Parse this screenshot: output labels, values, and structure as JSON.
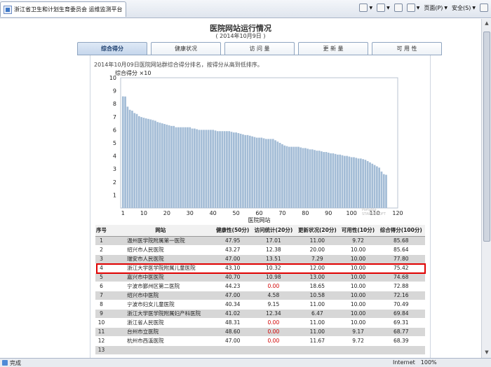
{
  "browser": {
    "tab_title": "浙江省卫生和计划生育委员会 运维监测平台",
    "tools": {
      "page": "页面(P)",
      "safety": "安全(S)"
    },
    "status": {
      "done": "完成",
      "zone": "Internet",
      "zoom": "100%"
    }
  },
  "page": {
    "title": "医院网站运行情况",
    "date": "( 2014年10月9日 )",
    "tabs": [
      {
        "label": "综合得分",
        "active": true
      },
      {
        "label": "健康状况",
        "active": false
      },
      {
        "label": "访 问 量",
        "active": false
      },
      {
        "label": "更 新 量",
        "active": false
      },
      {
        "label": "可 用 性",
        "active": false
      }
    ],
    "description": "2014年10月09日医院网站群综合得分排名，按得分从高到低排序。"
  },
  "chart_data": {
    "type": "bar",
    "ylabel": "综合得分 ×10",
    "xlabel": "医院网站",
    "ylim": [
      0,
      10
    ],
    "xlim": [
      0,
      120
    ],
    "yticks": [
      1,
      2,
      3,
      4,
      5,
      6,
      7,
      8,
      9,
      10
    ],
    "xticks": [
      1,
      10,
      20,
      30,
      40,
      50,
      60,
      70,
      80,
      90,
      100,
      110,
      120
    ],
    "bar_color": "#a3bcd6",
    "values": [
      8.57,
      8.56,
      7.78,
      7.54,
      7.47,
      7.29,
      7.22,
      7.05,
      6.98,
      6.93,
      6.88,
      6.84,
      6.8,
      6.75,
      6.7,
      6.6,
      6.55,
      6.5,
      6.45,
      6.4,
      6.35,
      6.3,
      6.3,
      6.2,
      6.2,
      6.2,
      6.2,
      6.2,
      6.2,
      6.2,
      6.1,
      6.1,
      6.05,
      6.0,
      6.0,
      6.0,
      6.0,
      6.0,
      6.0,
      6.0,
      5.95,
      5.9,
      5.9,
      5.9,
      5.9,
      5.9,
      5.9,
      5.85,
      5.8,
      5.8,
      5.75,
      5.7,
      5.65,
      5.6,
      5.6,
      5.55,
      5.5,
      5.45,
      5.4,
      5.4,
      5.4,
      5.35,
      5.3,
      5.3,
      5.3,
      5.3,
      5.2,
      5.1,
      5.0,
      4.9,
      4.8,
      4.75,
      4.7,
      4.7,
      4.7,
      4.7,
      4.7,
      4.65,
      4.6,
      4.6,
      4.55,
      4.5,
      4.5,
      4.45,
      4.4,
      4.4,
      4.35,
      4.3,
      4.3,
      4.25,
      4.2,
      4.2,
      4.15,
      4.1,
      4.1,
      4.05,
      4.0,
      4.0,
      3.95,
      3.9,
      3.9,
      3.85,
      3.8,
      3.8,
      3.75,
      3.7,
      3.6,
      3.5,
      3.4,
      3.3,
      3.2,
      3.1,
      2.8,
      2.6,
      2.55
    ]
  },
  "table": {
    "headers": [
      "序号",
      "网站",
      "健康性(50分)",
      "访问统计(20分)",
      "更新状况(20分)",
      "可用性(10分)",
      "综合得分(100分)"
    ],
    "rows": [
      [
        "1",
        "温州医学院附属第一医院",
        "47.95",
        "17.01",
        "11.00",
        "9.72",
        "85.68"
      ],
      [
        "2",
        "绍兴市人民医院",
        "43.27",
        "12.38",
        "20.00",
        "10.00",
        "85.64"
      ],
      [
        "3",
        "瑞安市人民医院",
        "47.00",
        "13.51",
        "7.29",
        "10.00",
        "77.80"
      ],
      [
        "4",
        "浙江大学医学院附属儿童医院",
        "43.10",
        "10.32",
        "12.00",
        "10.00",
        "75.42"
      ],
      [
        "5",
        "嘉兴市中医医院",
        "40.70",
        "10.98",
        "13.00",
        "10.00",
        "74.68"
      ],
      [
        "6",
        "宁波市鄞州区第二医院",
        "44.23",
        "0.00",
        "18.65",
        "10.00",
        "72.88"
      ],
      [
        "7",
        "绍兴市中医院",
        "47.00",
        "4.58",
        "10.58",
        "10.00",
        "72.16"
      ],
      [
        "8",
        "宁波市妇女儿童医院",
        "40.34",
        "9.15",
        "11.00",
        "10.00",
        "70.49"
      ],
      [
        "9",
        "浙江大学医学院附属妇产科医院",
        "41.02",
        "12.34",
        "6.47",
        "10.00",
        "69.84"
      ],
      [
        "10",
        "浙江省人民医院",
        "48.31",
        "0.00",
        "11.00",
        "10.00",
        "69.31"
      ],
      [
        "11",
        "台州市立医院",
        "48.60",
        "0.00",
        "11.00",
        "9.17",
        "68.77"
      ],
      [
        "12",
        "杭州市西溪医院",
        "47.00",
        "0.00",
        "11.67",
        "9.72",
        "68.39"
      ],
      [
        "13",
        "",
        "",
        "",
        "",
        "",
        ""
      ]
    ],
    "highlight_row": 2,
    "zero_color": "#d00000"
  },
  "watermark": [
    "Portable",
    "STARRIBSOFT"
  ]
}
